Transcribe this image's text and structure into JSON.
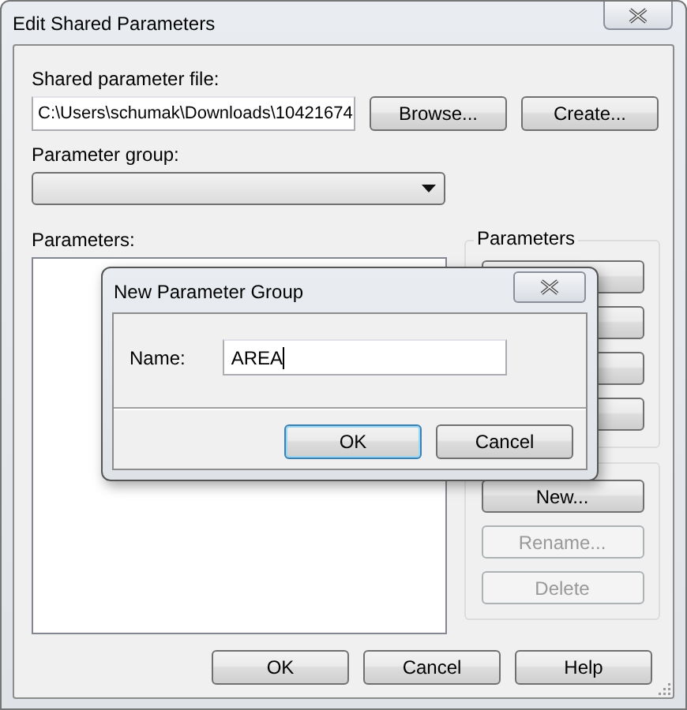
{
  "window": {
    "title": "Edit Shared Parameters"
  },
  "file": {
    "label": "Shared parameter file:",
    "value": "C:\\Users\\schumak\\Downloads\\10421674",
    "buttons": [
      "Browse...",
      "Create..."
    ]
  },
  "parameter_group": {
    "label": "Parameter group:"
  },
  "parameters": {
    "label": "Parameters:"
  },
  "parameters_box": {
    "label": "Parameters"
  },
  "groups_box": {
    "buttons": [
      {
        "label": "New...",
        "disabled": false
      },
      {
        "label": "Rename...",
        "disabled": true
      },
      {
        "label": "Delete",
        "disabled": true
      }
    ]
  },
  "buttons": [
    "OK",
    "Cancel",
    "Help"
  ],
  "dialog": {
    "title": "New Parameter Group",
    "name_label": "Name:",
    "name_value": "AREA",
    "buttons": [
      "OK",
      "Cancel"
    ]
  }
}
